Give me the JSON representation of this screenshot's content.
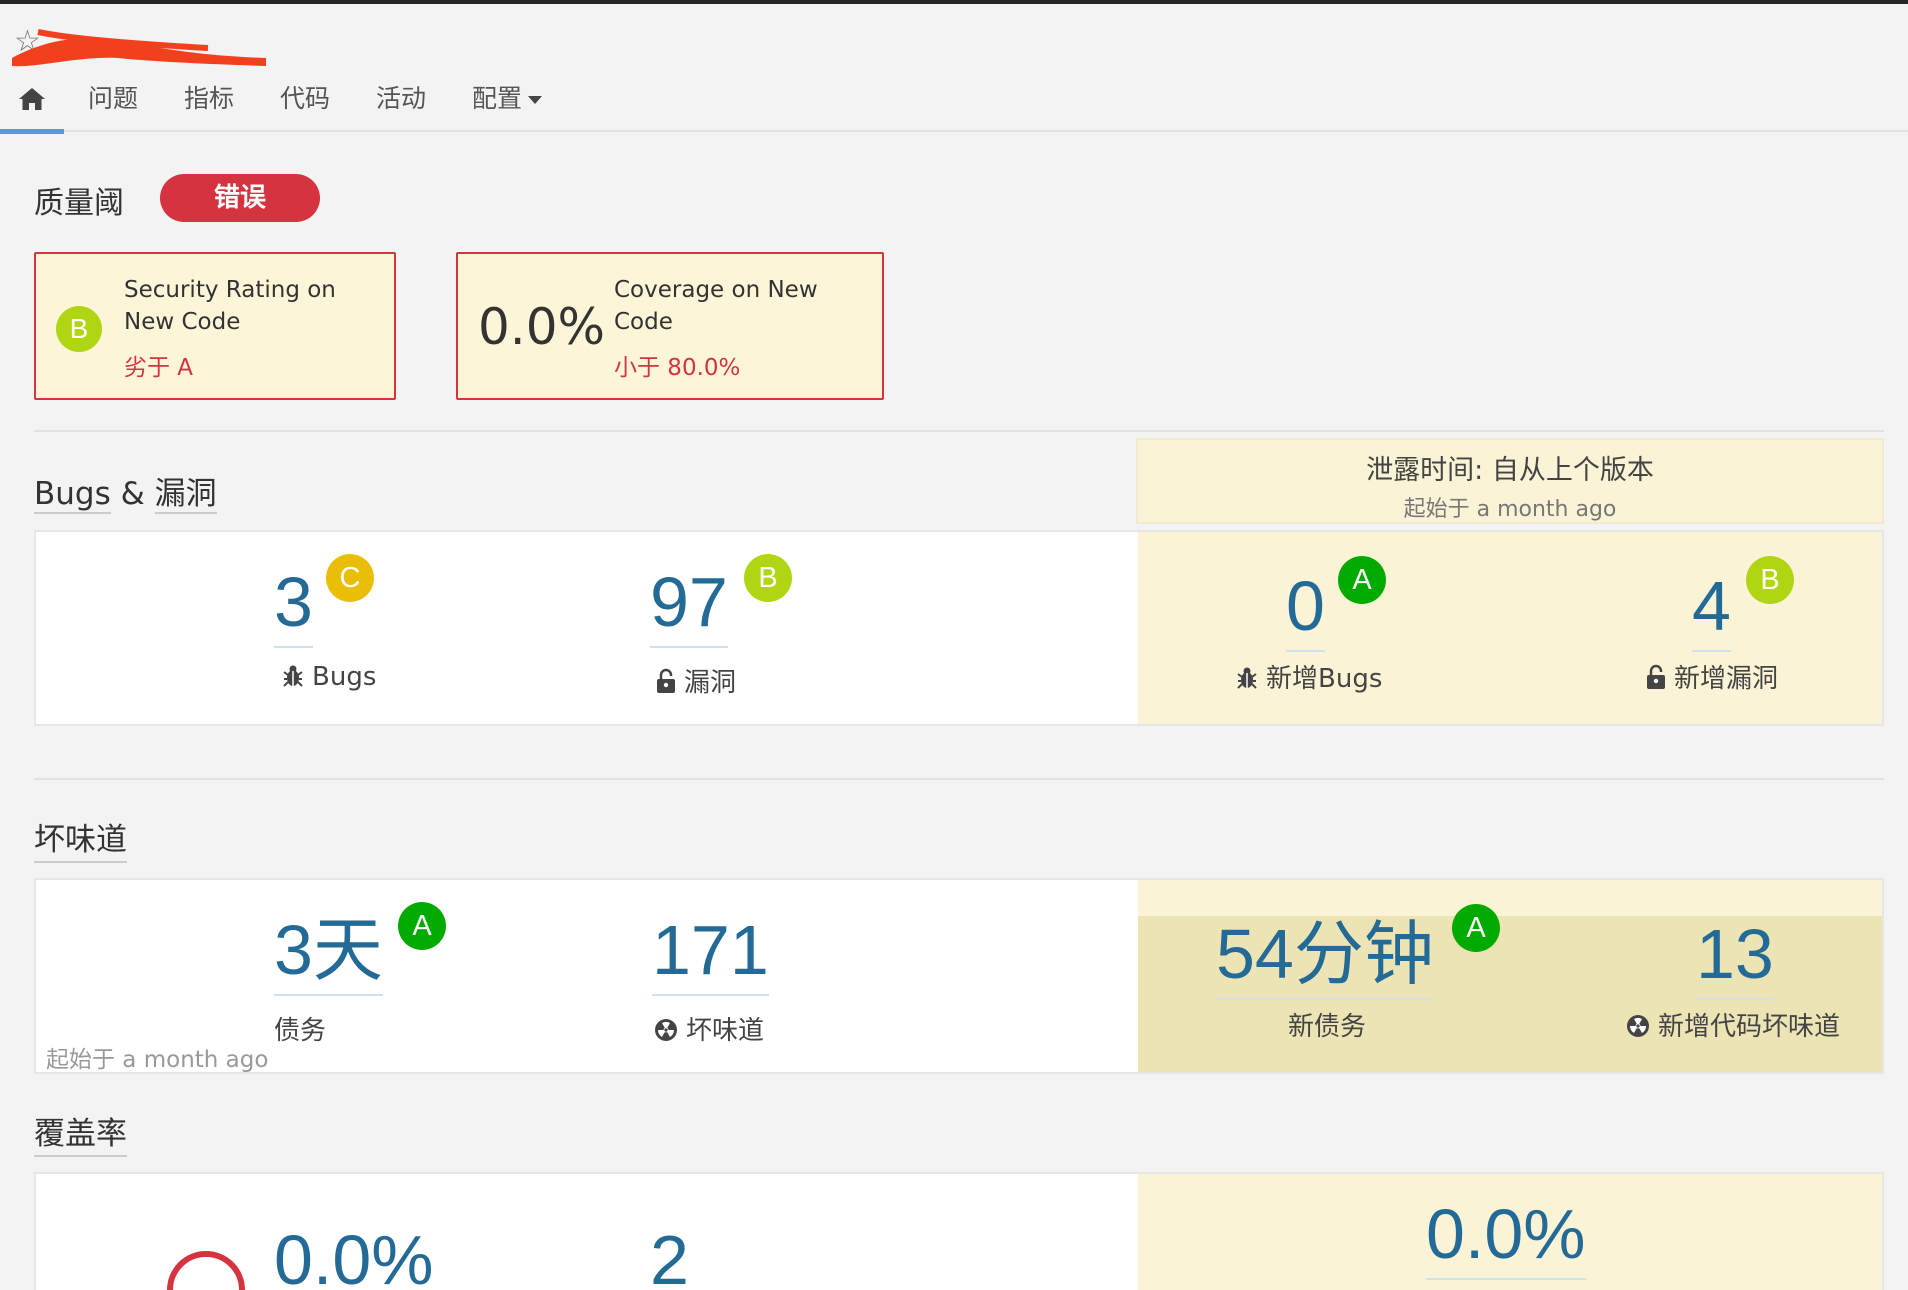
{
  "nav": {
    "tabs": [
      "问题",
      "指标",
      "代码",
      "活动",
      "配置"
    ]
  },
  "quality_gate": {
    "title": "质量阈",
    "status": "错误",
    "conditions": [
      {
        "rating": "B",
        "label_line1": "Security Rating on",
        "label_line2": "New Code",
        "failure": "劣于 A"
      },
      {
        "value": "0.0%",
        "label_line1": "Coverage on New",
        "label_line2": "Code",
        "failure": "小于 80.0%"
      }
    ]
  },
  "leak_period": {
    "title": "泄露时间: 自从上个版本",
    "since": "起始于 a month ago"
  },
  "bugs_section": {
    "title_part1": "Bugs",
    "title_amp": "&",
    "title_part2": "漏洞",
    "bugs": {
      "value": "3",
      "rating": "C",
      "label": "Bugs"
    },
    "vulnerabilities": {
      "value": "97",
      "rating": "B",
      "label": "漏洞"
    },
    "new_bugs": {
      "value": "0",
      "rating": "A",
      "label": "新增Bugs"
    },
    "new_vulnerabilities": {
      "value": "4",
      "rating": "B",
      "label": "新增漏洞"
    }
  },
  "smells_section": {
    "title": "坏味道",
    "debt": {
      "value": "3天",
      "rating": "A",
      "label": "债务"
    },
    "smells": {
      "value": "171",
      "label": "坏味道"
    },
    "since": "起始于 a month ago",
    "new_debt": {
      "value": "54分钟",
      "rating": "A",
      "label": "新债务"
    },
    "new_smells": {
      "value": "13",
      "label": "新增代码坏味道"
    }
  },
  "coverage_section": {
    "title": "覆盖率",
    "coverage": {
      "value": "0.0%"
    },
    "tests": {
      "value": "2"
    },
    "new_coverage": {
      "value": "0.0%"
    }
  },
  "colors": {
    "error": "#d4333f",
    "rating_A": "#00aa00",
    "rating_B": "#b0d513",
    "rating_C": "#eabe06",
    "metric": "#236a97",
    "leak_bg": "#fbf3d5"
  },
  "icons": [
    "home-icon",
    "star-icon",
    "bug-icon",
    "lock-icon",
    "radiation-icon",
    "caret-down-icon"
  ]
}
